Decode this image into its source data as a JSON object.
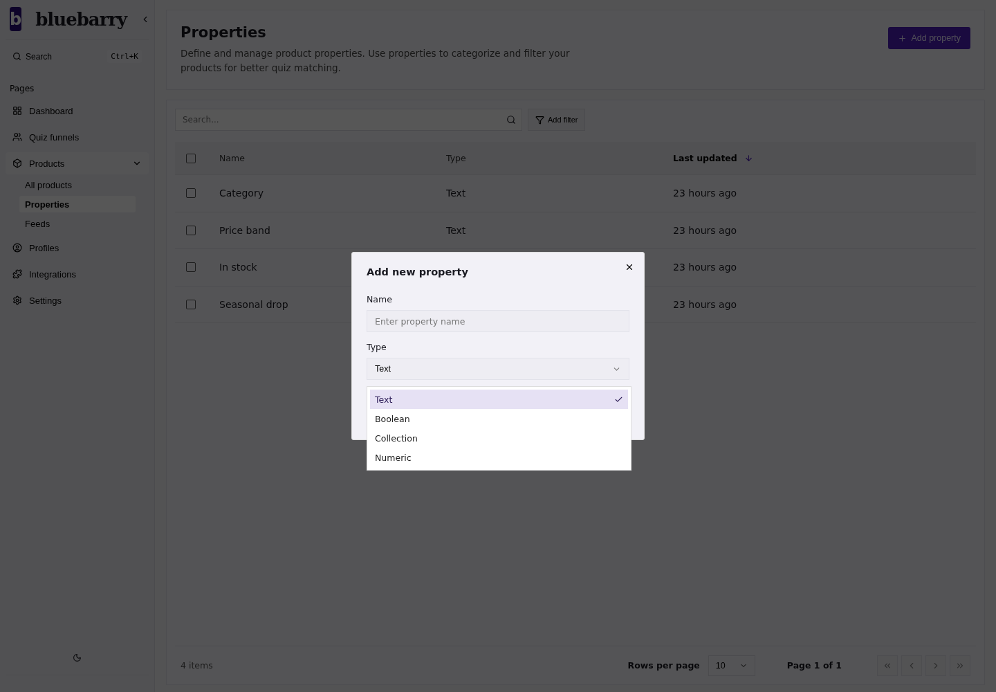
{
  "sidebar": {
    "logo_letter": "b",
    "brand": "bluebarry",
    "search": {
      "label": "Search",
      "shortcut": "Ctrl+K"
    },
    "section": "Pages",
    "items": [
      {
        "label": "Dashboard",
        "selected": false
      },
      {
        "label": "Quiz funnels",
        "selected": false
      },
      {
        "label": "Products",
        "selected": false,
        "expanded": true,
        "children": [
          {
            "label": "All products",
            "selected": false
          },
          {
            "label": "Properties",
            "selected": true
          },
          {
            "label": "Feeds",
            "selected": false
          }
        ]
      },
      {
        "label": "Profiles",
        "selected": false
      },
      {
        "label": "Integrations",
        "selected": false
      },
      {
        "label": "Settings",
        "selected": false
      }
    ]
  },
  "header": {
    "title": "Properties",
    "description": "Define and manage product properties. Use properties to categorize and filter your products for better quiz matching.",
    "add_button": "Add property"
  },
  "toolbar": {
    "search_placeholder": "Search...",
    "filter_button": "Add filter"
  },
  "table": {
    "columns": [
      {
        "label": "Name",
        "sorted": false
      },
      {
        "label": "Type",
        "sorted": false
      },
      {
        "label": "Last updated",
        "sorted": true
      }
    ],
    "all_checked": false,
    "rows": [
      {
        "name": "Category",
        "type": "Text",
        "updated": "23 hours ago",
        "checked": false
      },
      {
        "name": "Price band",
        "type": "Text",
        "updated": "23 hours ago",
        "checked": false
      },
      {
        "name": "In stock",
        "updated": "23 hours ago",
        "checked": false
      },
      {
        "name": "Seasonal drop",
        "updated": "23 hours ago",
        "checked": false
      }
    ]
  },
  "footer": {
    "count": "4 items",
    "rows_label": "Rows per page",
    "rows_value": "10",
    "page": "Page 1 of 1"
  },
  "dialog": {
    "title": "Add new property",
    "name_label": "Name",
    "name_placeholder": "Enter property name",
    "type_label": "Type",
    "type_value": "Text",
    "options": [
      {
        "label": "Text",
        "selected": true
      },
      {
        "label": "Boolean",
        "selected": false
      },
      {
        "label": "Collection",
        "selected": false
      },
      {
        "label": "Numeric",
        "selected": false
      }
    ]
  }
}
